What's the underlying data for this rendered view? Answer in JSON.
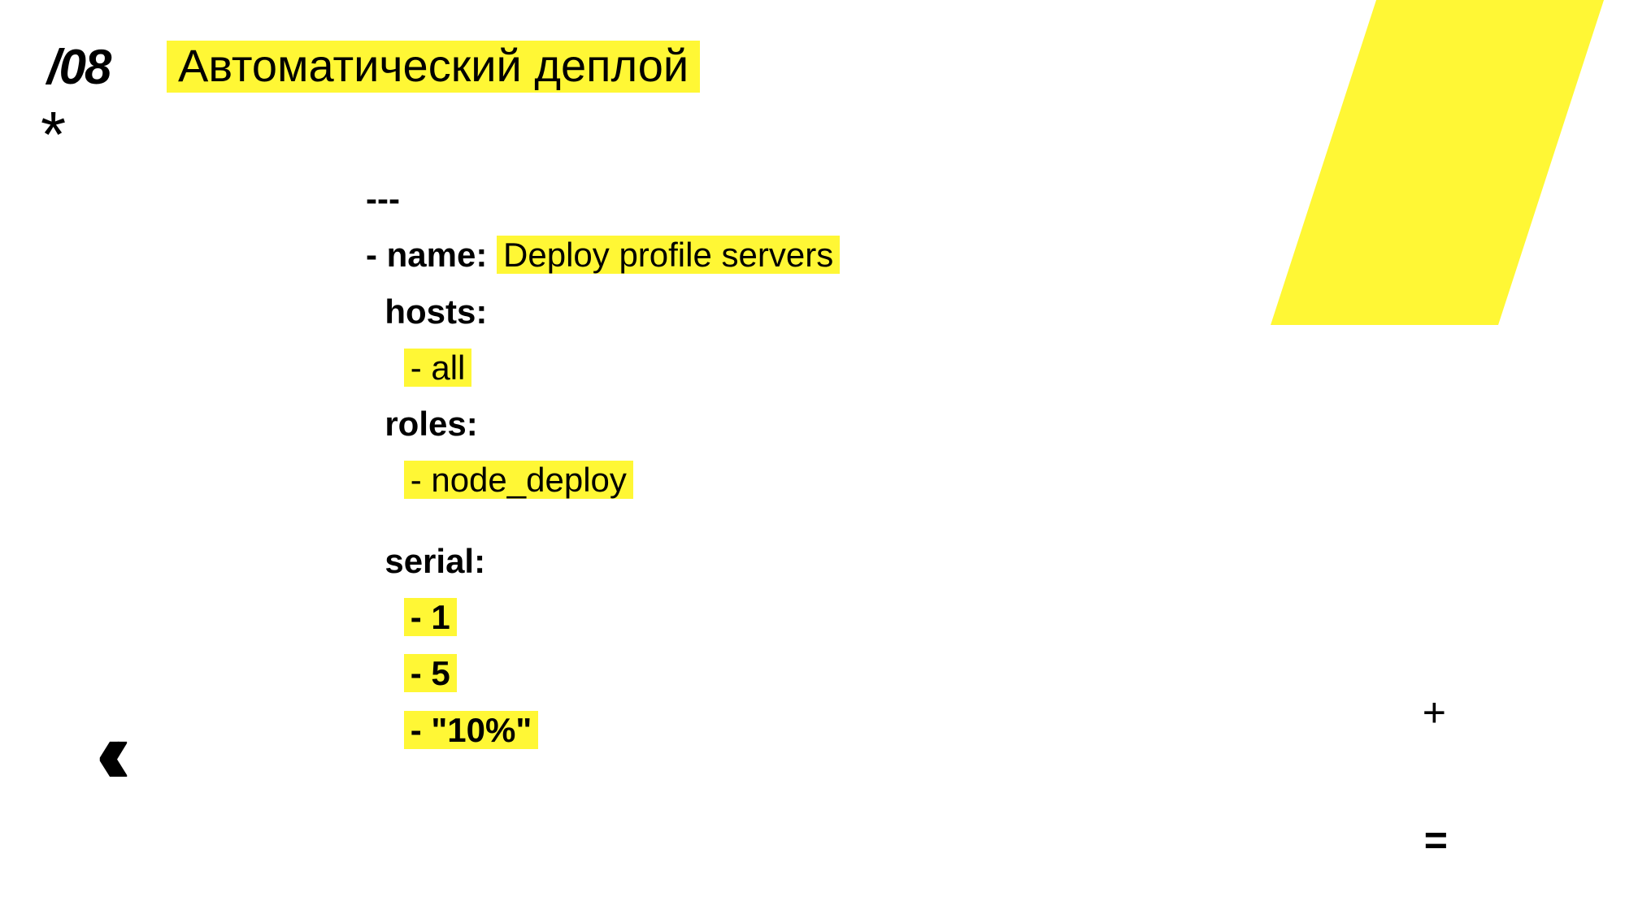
{
  "slide": {
    "number": "/08",
    "title": "Автоматический деплой",
    "asterisk": "*"
  },
  "code": {
    "line1": "---",
    "name_label": "- name: ",
    "name_value": "Deploy profile servers",
    "hosts_label": "  hosts:",
    "hosts_item": "- all",
    "roles_label": "  roles:",
    "roles_item": "- node_deploy",
    "serial_label": "  serial:",
    "serial_item1": "- 1",
    "serial_item2": "- 5",
    "serial_item3": "- \"10%\""
  },
  "decorations": {
    "chevrons": "‹‹",
    "plus": "+",
    "equals": "="
  }
}
